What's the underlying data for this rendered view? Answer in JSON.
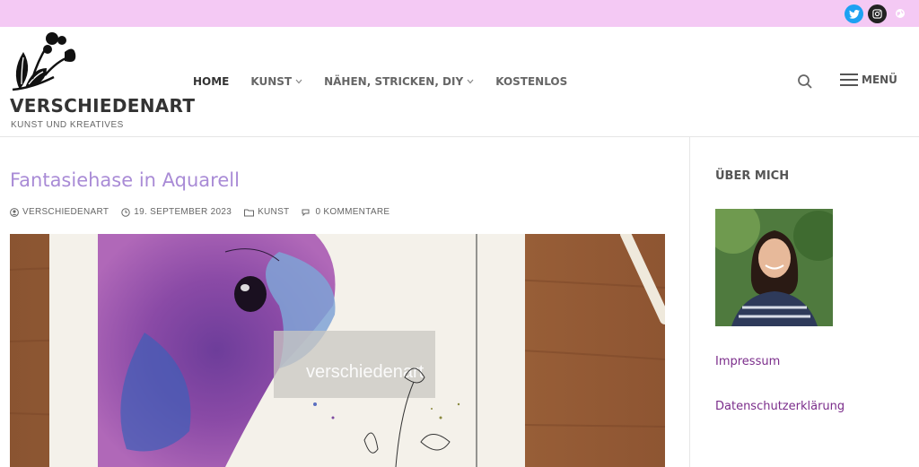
{
  "topbar": {
    "social": [
      "twitter-icon",
      "instagram-icon",
      "globe-icon"
    ],
    "bg_color": "#f4c9f4"
  },
  "header": {
    "site_title": "VERSCHIEDENART",
    "tagline": "KUNST UND KREATIVES",
    "nav": [
      {
        "label": "HOME",
        "dropdown": false,
        "active": true
      },
      {
        "label": "KUNST",
        "dropdown": true,
        "active": false
      },
      {
        "label": "NÄHEN, STRICKEN, DIY",
        "dropdown": true,
        "active": false
      },
      {
        "label": "KOSTENLOS",
        "dropdown": false,
        "active": false
      }
    ],
    "menu_label": "MENÜ"
  },
  "post": {
    "title": "Fantasiehase in Aquarell",
    "author": "VERSCHIEDENART",
    "date": "19. SEPTEMBER 2023",
    "category": "KUNST",
    "comments": "0 KOMMENTARE",
    "watermark": "verschiedenart"
  },
  "sidebar": {
    "title": "ÜBER MICH",
    "links": [
      "Impressum",
      "Datenschutzerklärung"
    ]
  },
  "colors": {
    "accent": "#a98bd6",
    "link": "#7b2d8b",
    "twitter": "#1da1f2"
  }
}
